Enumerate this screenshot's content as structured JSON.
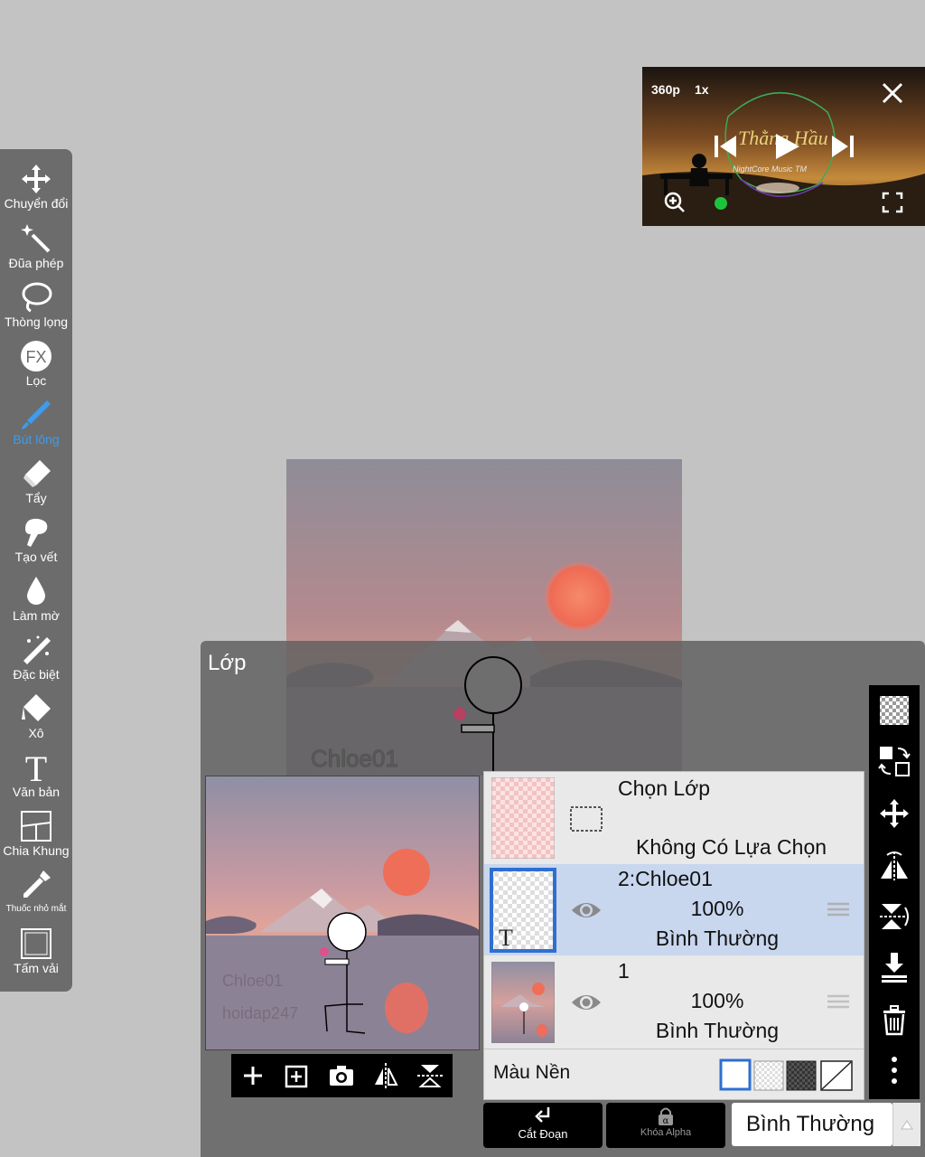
{
  "toolbar": {
    "items": [
      {
        "label": "Chuyển đổi",
        "icon": "move-icon"
      },
      {
        "label": "Đũa phép",
        "icon": "magic-wand-icon"
      },
      {
        "label": "Thòng lọng",
        "icon": "lasso-icon"
      },
      {
        "label": "Lọc",
        "icon": "fx-filter-icon"
      },
      {
        "label": "Bút lông",
        "icon": "brush-icon"
      },
      {
        "label": "Tẩy",
        "icon": "eraser-icon"
      },
      {
        "label": "Tạo vết",
        "icon": "smudge-icon"
      },
      {
        "label": "Làm mờ",
        "icon": "blur-drop-icon"
      },
      {
        "label": "Đặc biệt",
        "icon": "special-wand-icon"
      },
      {
        "label": "Xô",
        "icon": "bucket-icon"
      },
      {
        "label": "Văn bản",
        "icon": "text-icon"
      },
      {
        "label": "Chia Khung",
        "icon": "frame-divider-icon"
      },
      {
        "label": "Thuốc nhỏ mắt",
        "icon": "eyedropper-icon"
      },
      {
        "label": "Tấm vải",
        "icon": "canvas-icon"
      }
    ],
    "active": "Bút lông",
    "active_color": "#3b9cf0"
  },
  "video": {
    "quality": "360p",
    "speed": "1x",
    "title_overlay": "Thằng Hầu",
    "subtitle_overlay": "NightCore Music TM"
  },
  "canvas": {
    "watermark_1": "Chloe01",
    "watermark_2": "hoidap247"
  },
  "layer_panel": {
    "title": "Lớp",
    "selection_row": {
      "title": "Chọn Lớp",
      "status": "Không Có Lựa Chọn"
    },
    "layers": [
      {
        "name": "2:Chloe01",
        "opacity": "100%",
        "blend": "Bình Thường",
        "selected": true
      },
      {
        "name": "1",
        "opacity": "100%",
        "blend": "Bình Thường",
        "selected": false
      }
    ],
    "background_label": "Màu Nền",
    "clip_label": "Cắt Đoạn",
    "alpha_lock_label": "Khóa Alpha",
    "blend_mode": "Bình Thường"
  }
}
